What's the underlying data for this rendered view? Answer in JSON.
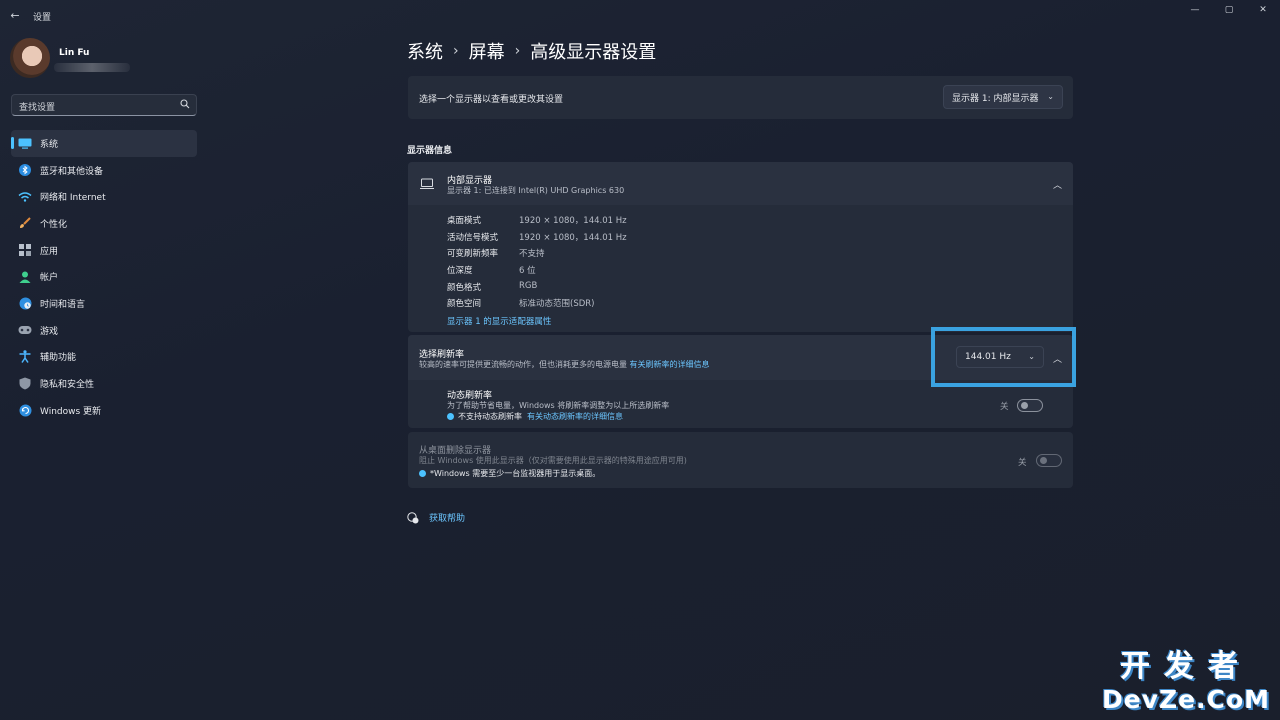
{
  "window": {
    "title": "设置",
    "back_icon": "←",
    "controls": [
      "—",
      "▢",
      "✕"
    ]
  },
  "profile": {
    "name": "Lin Fu"
  },
  "search": {
    "placeholder": "查找设置"
  },
  "sidebar": {
    "items": [
      {
        "label": "系统",
        "icon": "system-icon",
        "active": true
      },
      {
        "label": "蓝牙和其他设备",
        "icon": "bluetooth-icon"
      },
      {
        "label": "网络和 Internet",
        "icon": "network-icon"
      },
      {
        "label": "个性化",
        "icon": "brush-icon"
      },
      {
        "label": "应用",
        "icon": "apps-icon"
      },
      {
        "label": "帐户",
        "icon": "account-icon"
      },
      {
        "label": "时间和语言",
        "icon": "globe-icon"
      },
      {
        "label": "游戏",
        "icon": "gamepad-icon"
      },
      {
        "label": "辅助功能",
        "icon": "accessibility-icon"
      },
      {
        "label": "隐私和安全性",
        "icon": "shield-icon"
      },
      {
        "label": "Windows 更新",
        "icon": "update-icon"
      }
    ]
  },
  "breadcrumb": {
    "items": [
      "系统",
      "屏幕",
      "高级显示器设置"
    ],
    "separator": "›"
  },
  "select_display": {
    "label": "选择一个显示器以查看或更改其设置",
    "value": "显示器 1: 内部显示器"
  },
  "display_info": {
    "section_title": "显示器信息",
    "name": "内部显示器",
    "subtitle": "显示器 1: 已连接到 Intel(R) UHD Graphics 630",
    "rows": [
      {
        "label": "桌面模式",
        "value": "1920 × 1080，144.01 Hz"
      },
      {
        "label": "活动信号模式",
        "value": "1920 × 1080，144.01 Hz"
      },
      {
        "label": "可变刷新频率",
        "value": "不支持"
      },
      {
        "label": "位深度",
        "value": "6 位"
      },
      {
        "label": "颜色格式",
        "value": "RGB"
      },
      {
        "label": "颜色空间",
        "value": "标准动态范围(SDR)"
      }
    ],
    "adapter_link": "显示器 1 的显示适配器属性"
  },
  "refresh_rate": {
    "title": "选择刷新率",
    "subtitle": "较高的速率可提供更流畅的动作，但也消耗更多的电源电量",
    "subtitle_link": "有关刷新率的详细信息",
    "value": "144.01 Hz",
    "dynamic": {
      "title": "动态刷新率",
      "subtitle": "为了帮助节省电量，Windows 将刷新率调整为以上所选刷新率",
      "note": "不支持动态刷新率",
      "note_link": "有关动态刷新率的详细信息",
      "toggle_label": "关",
      "enabled": false
    }
  },
  "remove_display": {
    "title": "从桌面删除显示器",
    "subtitle": "阻止 Windows 使用此显示器（仅对需要使用此显示器的特殊用途应用可用)",
    "note": "*Windows 需要至少一台监视器用于显示桌面。",
    "toggle_label": "关",
    "enabled": false
  },
  "help": {
    "label": "获取帮助"
  },
  "watermark": {
    "top": "开发者",
    "bottom": "DevZe.CoM"
  },
  "colors": {
    "accent": "#4cc2ff",
    "link": "#6cc6ff",
    "highlight": "#3aa2e0",
    "card": "#252c3a"
  }
}
